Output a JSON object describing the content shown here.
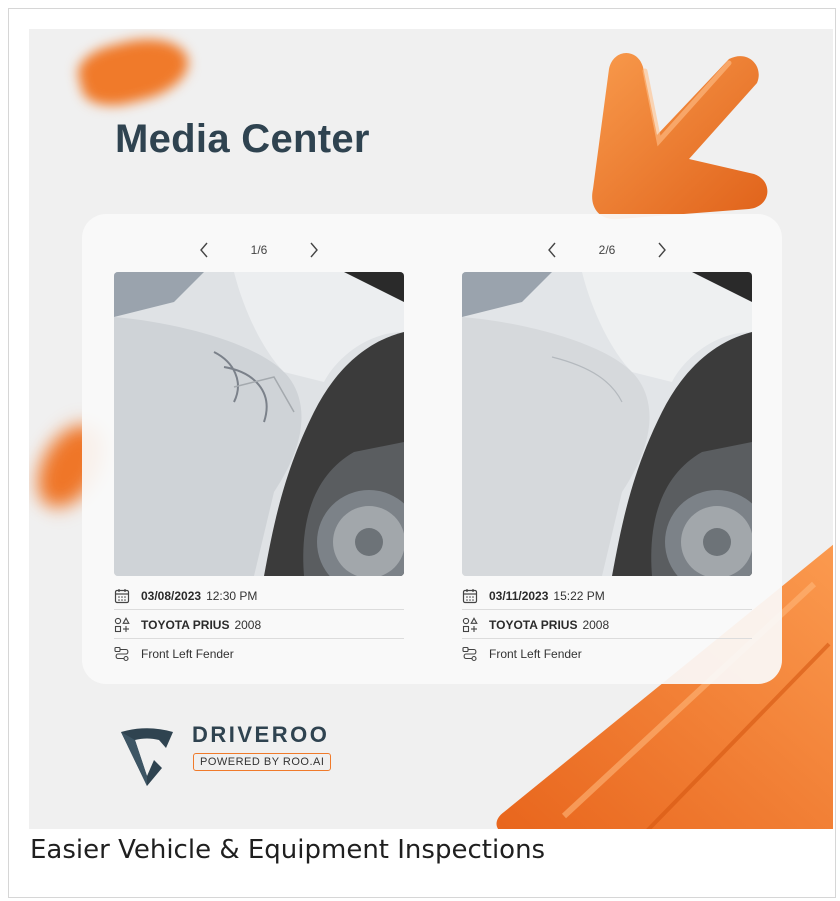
{
  "banner": {
    "title": "Media Center",
    "accent_color": "#f07a2a",
    "text_color": "#2f4350"
  },
  "gallery": [
    {
      "counter": "1/6",
      "date": "03/08/2023",
      "time": "12:30 PM",
      "vehicle": "TOYOTA PRIUS",
      "year": "2008",
      "part": "Front Left Fender",
      "photo_icon": "damaged-car-fender-photo"
    },
    {
      "counter": "2/6",
      "date": "03/11/2023",
      "time": "15:22 PM",
      "vehicle": "TOYOTA PRIUS",
      "year": "2008",
      "part": "Front Left Fender",
      "photo_icon": "repaired-car-fender-photo"
    }
  ],
  "logo": {
    "wordmark": "DRIVEROO",
    "tagline": "POWERED BY ROO.AI"
  },
  "caption": "Easier Vehicle & Equipment Inspections"
}
